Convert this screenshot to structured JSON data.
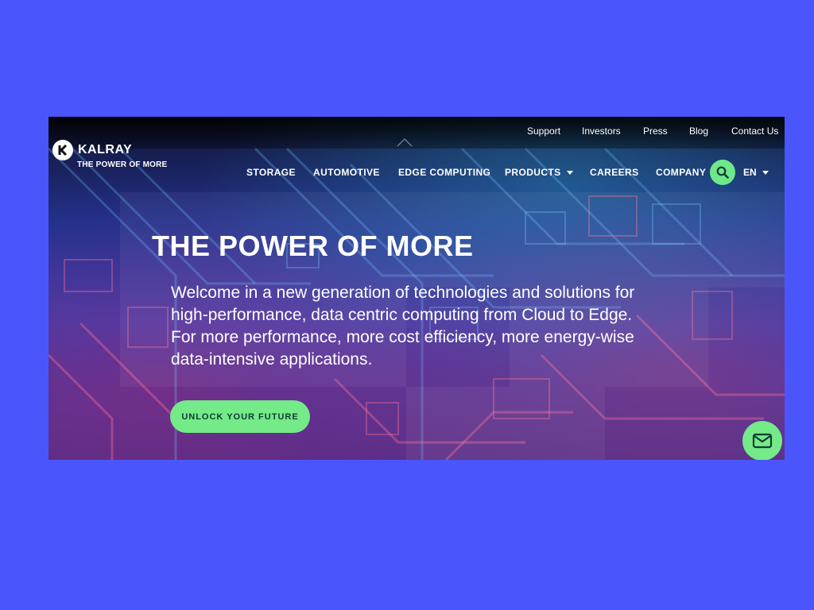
{
  "brand": {
    "name": "KALRAY",
    "tagline": "THE POWER OF MORE",
    "logo_icon": "kalray-k-logo"
  },
  "utility_nav": [
    "Support",
    "Investors",
    "Press",
    "Blog",
    "Contact Us"
  ],
  "main_nav": [
    {
      "label": "STORAGE"
    },
    {
      "label": "AUTOMOTIVE"
    },
    {
      "label": "EDGE COMPUTING"
    },
    {
      "label": "PRODUCTS",
      "has_dropdown": true
    },
    {
      "label": "CAREERS"
    },
    {
      "label": "COMPANY"
    }
  ],
  "search": {
    "icon": "search-icon"
  },
  "language": {
    "label": "EN",
    "icon": "chevron-down-icon"
  },
  "hero": {
    "title": "THE POWER OF MORE",
    "description": "Welcome in a new generation of technologies and solutions for high-performance, data centric computing from Cloud to Edge. For more performance, more cost efficiency, more energy-wise data-intensive applications.",
    "cta_label": "UNLOCK YOUR FUTURE"
  },
  "contact_widget": {
    "icon": "mail-icon"
  },
  "colors": {
    "page_background": "#4a56fb",
    "accent_green": "#74ea88",
    "cta_text": "#0e3b33"
  }
}
